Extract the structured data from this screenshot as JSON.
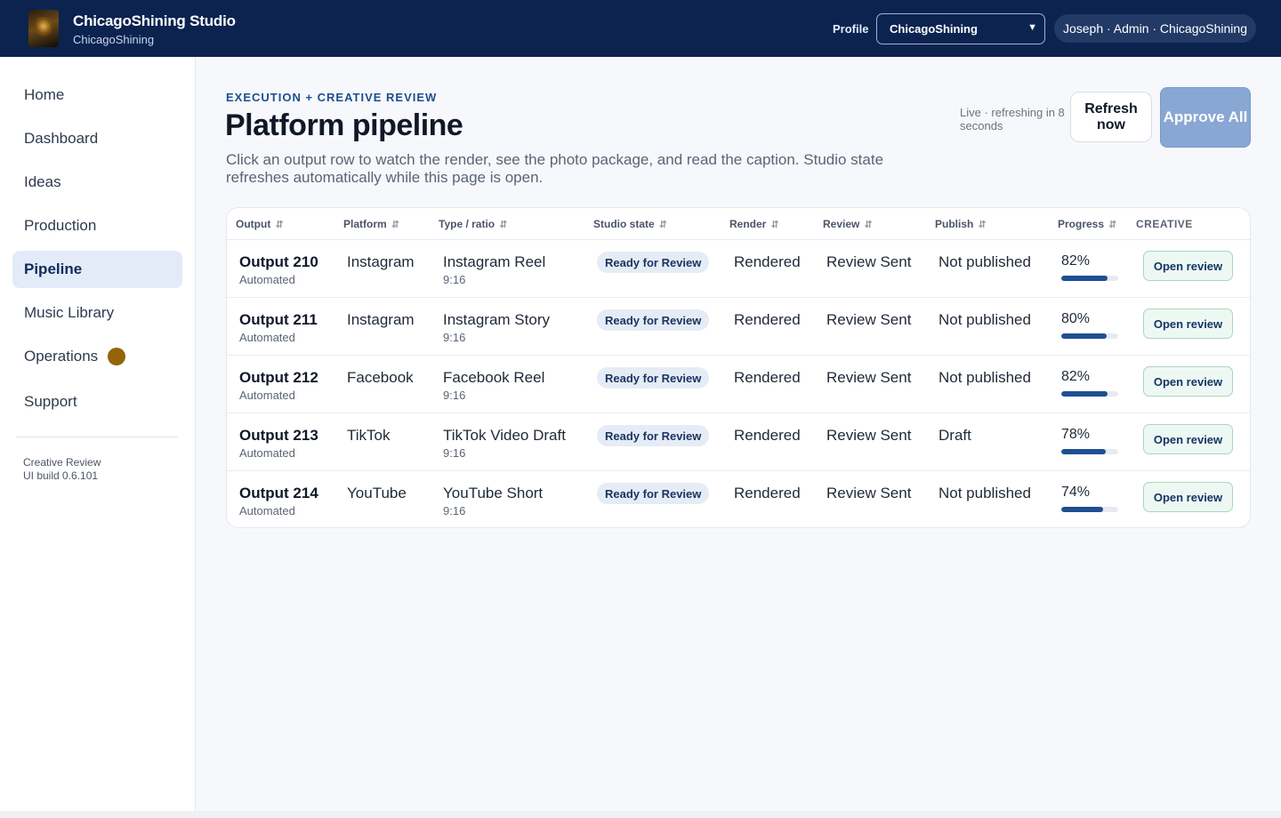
{
  "header": {
    "app_title": "ChicagoShining Studio",
    "app_subtitle": "ChicagoShining",
    "profile_label": "Profile",
    "profile_selected": "ChicagoShining",
    "user_info": "Joseph · Admin · ChicagoShining"
  },
  "sidebar": {
    "items": [
      {
        "label": "Home",
        "active": false
      },
      {
        "label": "Dashboard",
        "active": false
      },
      {
        "label": "Ideas",
        "active": false
      },
      {
        "label": "Production",
        "active": false
      },
      {
        "label": "Pipeline",
        "active": true
      },
      {
        "label": "Music Library",
        "active": false
      },
      {
        "label": "Operations",
        "active": false,
        "indicator_color": "#946407"
      },
      {
        "label": "Support",
        "active": false
      }
    ],
    "footer_line1": "Creative Review",
    "footer_line2": "UI build 0.6.101"
  },
  "main": {
    "eyebrow": "EXECUTION + CREATIVE REVIEW",
    "title": "Platform pipeline",
    "description": "Click an output row to watch the render, see the photo package, and read the caption. Studio state refreshes automatically while this page is open.",
    "live_status": "Live · refreshing in 8 seconds",
    "refresh_label": "Refresh now",
    "approve_label": "Approve All"
  },
  "table": {
    "headers": {
      "output": "Output",
      "platform": "Platform",
      "type": "Type / ratio",
      "studio_state": "Studio state",
      "render": "Render",
      "review": "Review",
      "publish": "Publish",
      "progress": "Progress",
      "creative": "CREATIVE"
    },
    "rows": [
      {
        "output": "Output 210",
        "sub": "Automated",
        "platform": "Instagram",
        "type": "Instagram Reel",
        "ratio": "9:16",
        "state": "Ready for Review",
        "render": "Rendered",
        "review": "Review Sent",
        "publish": "Not published",
        "progress": "82%",
        "progress_value": 0.82,
        "action": "Open review"
      },
      {
        "output": "Output 211",
        "sub": "Automated",
        "platform": "Instagram",
        "type": "Instagram Story",
        "ratio": "9:16",
        "state": "Ready for Review",
        "render": "Rendered",
        "review": "Review Sent",
        "publish": "Not published",
        "progress": "80%",
        "progress_value": 0.8,
        "action": "Open review"
      },
      {
        "output": "Output 212",
        "sub": "Automated",
        "platform": "Facebook",
        "type": "Facebook Reel",
        "ratio": "9:16",
        "state": "Ready for Review",
        "render": "Rendered",
        "review": "Review Sent",
        "publish": "Not published",
        "progress": "82%",
        "progress_value": 0.82,
        "action": "Open review"
      },
      {
        "output": "Output 213",
        "sub": "Automated",
        "platform": "TikTok",
        "type": "TikTok Video Draft",
        "ratio": "9:16",
        "state": "Ready for Review",
        "render": "Rendered",
        "review": "Review Sent",
        "publish": "Draft",
        "progress": "78%",
        "progress_value": 0.78,
        "action": "Open review"
      },
      {
        "output": "Output 214",
        "sub": "Automated",
        "platform": "YouTube",
        "type": "YouTube Short",
        "ratio": "9:16",
        "state": "Ready for Review",
        "render": "Rendered",
        "review": "Review Sent",
        "publish": "Not published",
        "progress": "74%",
        "progress_value": 0.74,
        "action": "Open review"
      }
    ]
  },
  "colors": {
    "topbar": "#0c2350",
    "accent": "#1f4f92",
    "approve_button": "#89a7d3"
  }
}
